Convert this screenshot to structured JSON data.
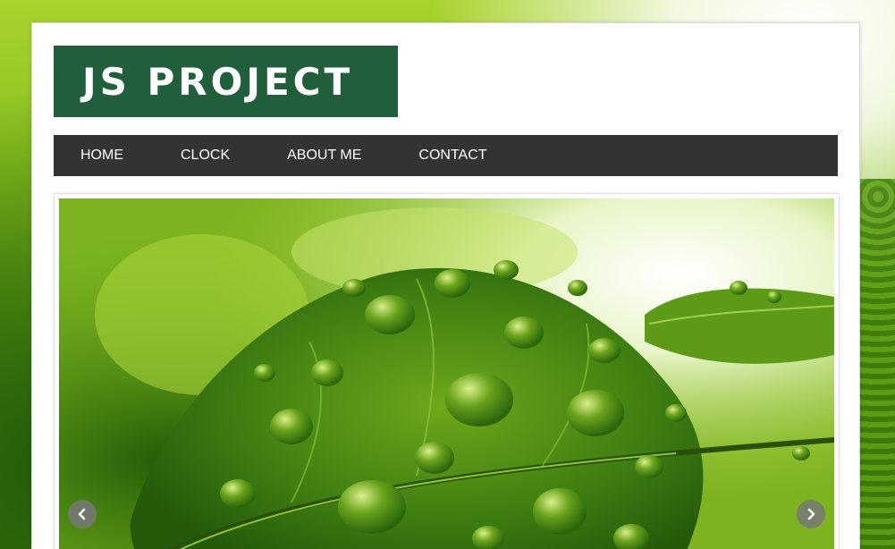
{
  "site": {
    "logo_text": "JS PROJECT"
  },
  "nav": {
    "items": [
      {
        "label": "HOME"
      },
      {
        "label": "CLOCK"
      },
      {
        "label": "ABOUT ME"
      },
      {
        "label": "CONTACT"
      }
    ]
  },
  "slider": {
    "image_subject": "green leaf with water droplets",
    "prev_icon": "chevron-left-icon",
    "next_icon": "chevron-right-icon"
  },
  "colors": {
    "logo_background": "#215e3c",
    "nav_background": "#333333",
    "nav_text": "#ffffff",
    "page_background": "#7fb81a"
  }
}
